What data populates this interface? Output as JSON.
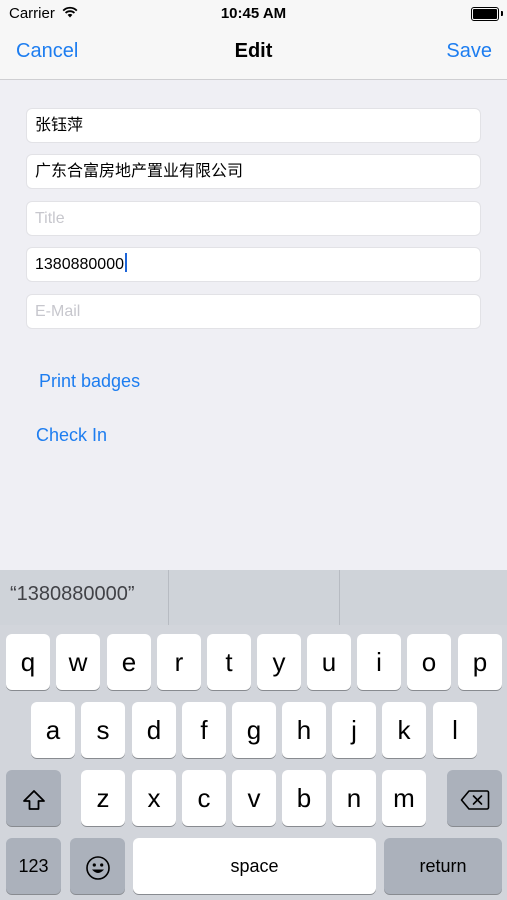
{
  "status_bar": {
    "carrier": "Carrier",
    "time": "10:45 AM"
  },
  "nav": {
    "cancel": "Cancel",
    "title": "Edit",
    "save": "Save"
  },
  "form": {
    "name_value": "张钰萍",
    "company_value": "广东合富房地产置业有限公司",
    "title_placeholder": "Title",
    "phone_value": "1380880000",
    "email_placeholder": "E-Mail"
  },
  "actions": {
    "print_badges": "Print badges",
    "check_in": "Check In"
  },
  "predictive": {
    "suggestion": "“1380880000”"
  },
  "keyboard": {
    "row1": [
      "q",
      "w",
      "e",
      "r",
      "t",
      "y",
      "u",
      "i",
      "o",
      "p"
    ],
    "row2": [
      "a",
      "s",
      "d",
      "f",
      "g",
      "h",
      "j",
      "k",
      "l"
    ],
    "row3": [
      "z",
      "x",
      "c",
      "v",
      "b",
      "n",
      "m"
    ],
    "numbers_key": "123",
    "space_key": "space",
    "return_key": "return",
    "shift_icon": "shift-icon",
    "delete_icon": "delete-icon",
    "emoji_icon": "emoji-icon"
  },
  "colors": {
    "accent": "#1d7df0",
    "caret": "#1d65d8",
    "keyboard_bg": "#d2d5db"
  }
}
